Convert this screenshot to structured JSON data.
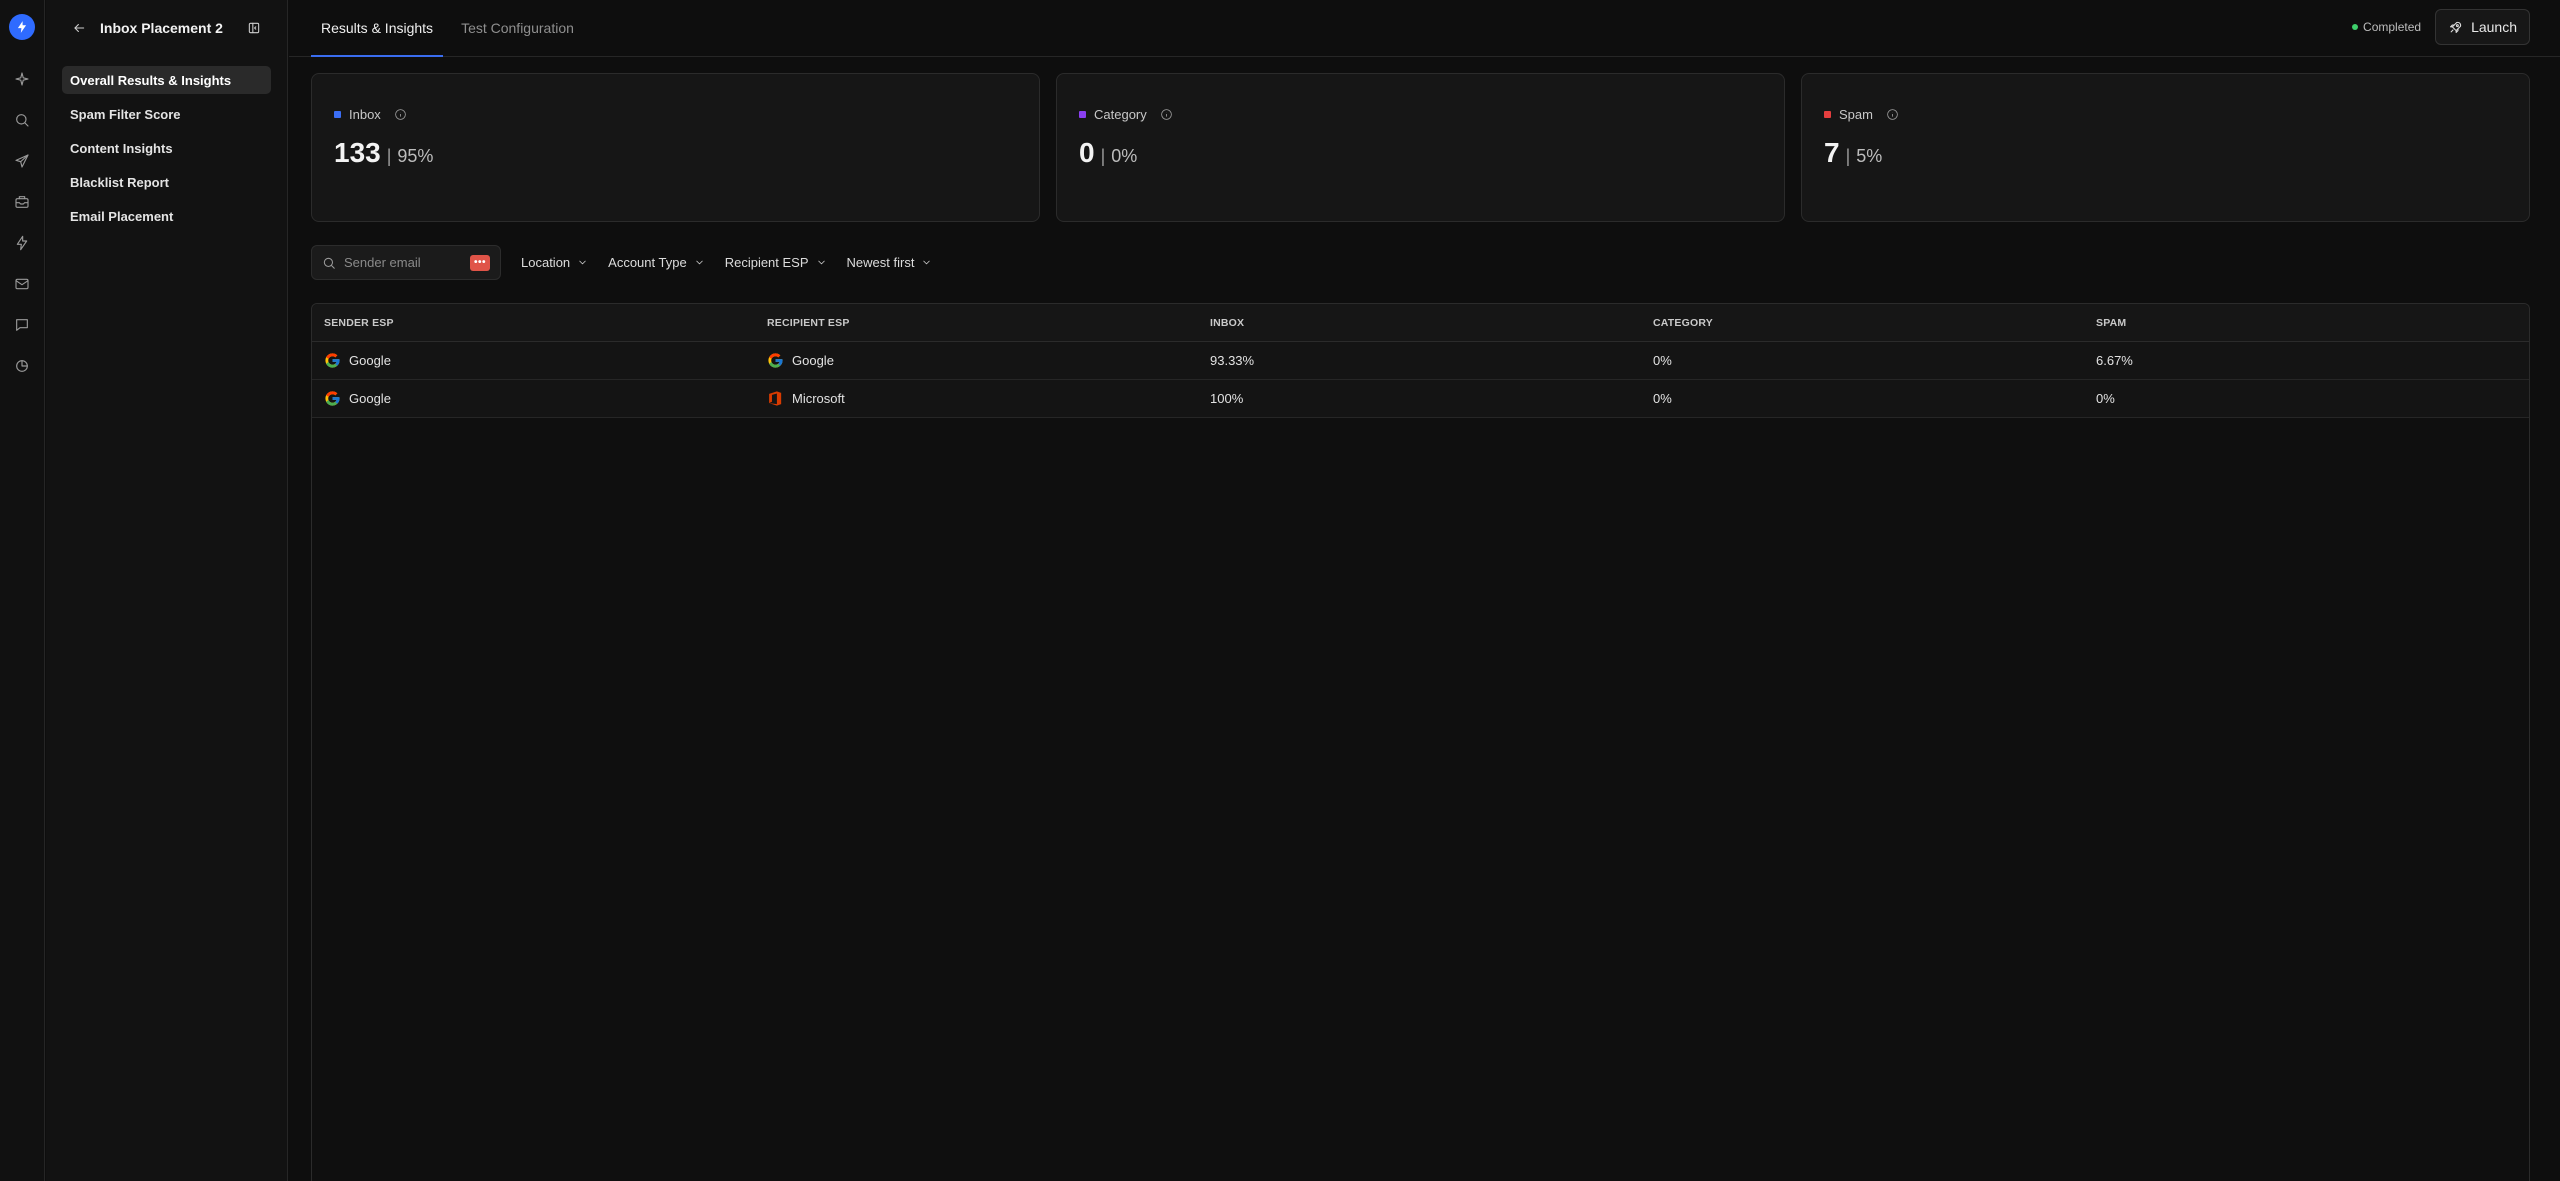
{
  "sidebar": {
    "title": "Inbox Placement 2",
    "items": [
      {
        "label": "Overall Results & Insights",
        "active": true
      },
      {
        "label": "Spam Filter Score"
      },
      {
        "label": "Content Insights"
      },
      {
        "label": "Blacklist Report"
      },
      {
        "label": "Email Placement"
      }
    ]
  },
  "rail_icons": [
    "bolt-logo",
    "sparkle-icon",
    "search-icon",
    "send-icon",
    "inbox-tray-icon",
    "lightning-icon",
    "mail-icon",
    "chat-icon",
    "analytics-icon"
  ],
  "tabs": [
    {
      "label": "Results & Insights",
      "active": true
    },
    {
      "label": "Test Configuration"
    }
  ],
  "header": {
    "status": "Completed",
    "status_color": "#3ecf6b",
    "launch_label": "Launch"
  },
  "cards": [
    {
      "label": "Inbox",
      "count": "133",
      "percent": "95%",
      "color": "#3b6ef5"
    },
    {
      "label": "Category",
      "count": "0",
      "percent": "0%",
      "color": "#8a3ff0"
    },
    {
      "label": "Spam",
      "count": "7",
      "percent": "5%",
      "color": "#e53e3e"
    }
  ],
  "filters": {
    "search_placeholder": "Sender email",
    "badge": "•••",
    "dropdowns": [
      "Location",
      "Account Type",
      "Recipient ESP",
      "Newest first"
    ]
  },
  "table": {
    "columns": [
      "SENDER ESP",
      "RECIPIENT ESP",
      "INBOX",
      "CATEGORY",
      "SPAM"
    ],
    "rows": [
      {
        "sender": "Google",
        "sender_icon": "google-icon",
        "recipient": "Google",
        "recipient_icon": "google-icon",
        "inbox": "93.33%",
        "category": "0%",
        "spam": "6.67%"
      },
      {
        "sender": "Google",
        "sender_icon": "google-icon",
        "recipient": "Microsoft",
        "recipient_icon": "microsoft-office-icon",
        "inbox": "100%",
        "category": "0%",
        "spam": "0%"
      }
    ]
  }
}
